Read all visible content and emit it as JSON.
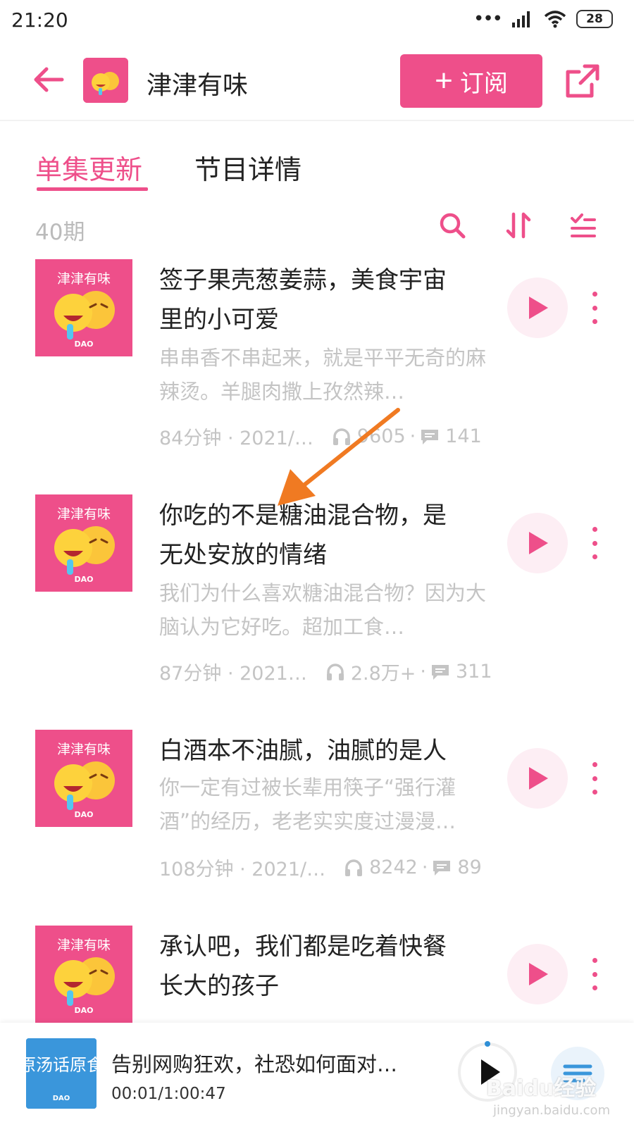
{
  "status_bar": {
    "time": "21:20",
    "battery": "28"
  },
  "header": {
    "title": "津津有味",
    "subscribe_label": "订阅"
  },
  "tabs": [
    {
      "label": "单集更新"
    },
    {
      "label": "节目详情"
    }
  ],
  "episode_count": "40期",
  "cover_text": "津津有味",
  "cover_brand": "DAO",
  "episodes": [
    {
      "title": "签子果壳葱姜蒜，美食宇宙里的小可爱",
      "desc": "串串香不串起来，就是平平无奇的麻辣烫。羊腿肉撒上孜然辣…",
      "duration": "84分钟 · 2021/…",
      "plays": "9605",
      "comments": "141"
    },
    {
      "title": "你吃的不是糖油混合物，是无处安放的情绪",
      "desc": "我们为什么喜欢糖油混合物？因为大脑认为它好吃。超加工食…",
      "duration": "87分钟 · 2021…",
      "plays": "2.8万+",
      "comments": "311"
    },
    {
      "title": "白酒本不油腻，油腻的是人",
      "desc": "你一定有过被长辈用筷子“强行灌酒”的经历，老老实实度过漫漫…",
      "duration": "108分钟 · 2021/…",
      "plays": "8242",
      "comments": "89"
    },
    {
      "title": "承认吧，我们都是吃着快餐长大的孩子",
      "desc": "",
      "duration": "",
      "plays": "",
      "comments": ""
    }
  ],
  "player": {
    "title": "告别网购狂欢，社恐如何面对…",
    "time": "00:01/1:00:47",
    "cover_text": "原汤话原食",
    "cover_brand": "DAO"
  },
  "watermark": {
    "main": "Baidu经验",
    "sub": "jingyan.baidu.com"
  },
  "colors": {
    "accent": "#ee4f8a",
    "arrow": "#f07a22"
  }
}
